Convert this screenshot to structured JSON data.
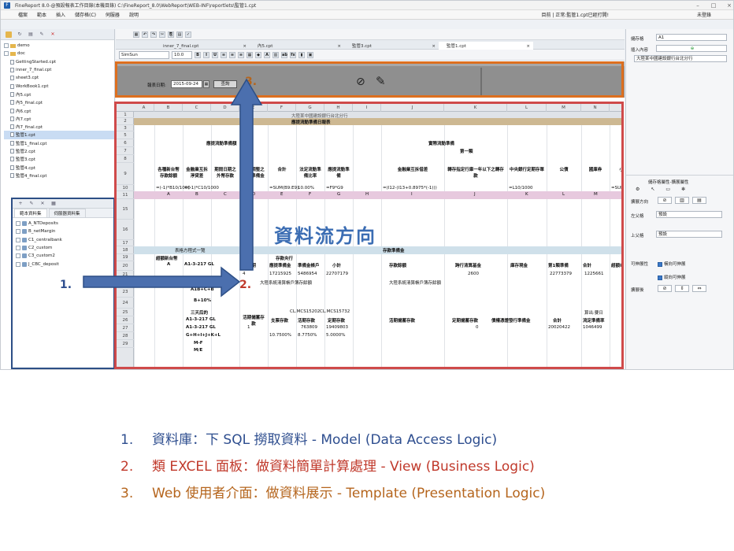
{
  "window": {
    "title": "FineReport 8.0-@預設報表工作目錄(本機目錄)   C:\\FineReport_8.0\\WebReport\\WEB-INF\\reportlets\\監管1.cpt",
    "status": "目前 | 正常:監管1.cpt已經打開!",
    "login": "未登錄"
  },
  "menu": [
    "檔案",
    "範本",
    "插入",
    "儲存格(C)",
    "伺服器",
    "說明"
  ],
  "file_tree": {
    "items": [
      "demo",
      "doc",
      "GettingStarted.cpt",
      "inner_7_final.cpt",
      "sheet3.cpt",
      "WorkBook1.cpt",
      "內5.cpt",
      "內5_final.cpt",
      "內6.cpt",
      "內7.cpt",
      "內7_final.cpt",
      "監管1.cpt",
      "監管1_final.cpt",
      "監管2.cpt",
      "監管3.cpt",
      "監管4.cpt",
      "監管4_final.cpt"
    ],
    "selected_index": 11
  },
  "datasets": {
    "tabs": [
      "範本資料集",
      "伺服器資料集"
    ],
    "items": [
      "A_NTDeposits",
      "B_netMargin",
      "C1_centralbank",
      "C2_custom",
      "C3_custom2",
      "J_CBC_deposit"
    ]
  },
  "editor": {
    "tabs": [
      "inner_7_final.cpt",
      "內5.cpt",
      "監管3.cpt",
      "監管1.cpt"
    ],
    "font": "SimSun",
    "font_size": "10.0"
  },
  "param_pane": {
    "date_label": "報表日期:",
    "date_value": "2015-09-24",
    "query_label": "查詢"
  },
  "grid": {
    "columns": [
      "A",
      "B",
      "C",
      "D",
      "E",
      "F",
      "G",
      "H",
      "I",
      "J",
      "K",
      "L",
      "M",
      "N",
      "O"
    ],
    "rows": [
      "1",
      "2",
      "3",
      "5",
      "6",
      "7",
      "8",
      "9",
      "10",
      "11",
      "15",
      "16",
      "17",
      "18",
      "19",
      "20",
      "21",
      "22",
      "23",
      "24",
      "25",
      "26",
      "27",
      "28",
      "29"
    ],
    "title1": "大陸某中國建設銀行台北分行",
    "title2": "應提流動準備日報表",
    "overlay_title": "資料流方向",
    "cells": {
      "h_left": "應提流動準備額",
      "h_right": "實際流動準備",
      "h_first": "第一類",
      "c_ntd": "各種新台幣存款餘額",
      "c_amt": "金融業互拆淨貸差",
      "c_redo": "期間日期之外幣存款",
      "c_ratio": "繼續調整之存款準備金",
      "c_sum": "合計",
      "c_legal": "法定流動準備比率",
      "c_need": "應提流動準備",
      "c_excess": "超額準備",
      "c_interbank": "金融業互拆借差",
      "c_central": "轉存指定行庫一年以下之轉存款",
      "c_cb": "中央銀行定期存單",
      "c_bond": "公債",
      "c_treasury": "國庫券",
      "c_total": "小計",
      "f_b9": "=(-1)*B10/1000",
      "f_c9": "=(-1)*C10/1000",
      "f_e9": "0.00",
      "f_f9": "=SUM(B9:E9)",
      "f_g9": "10.00%",
      "f_h9": "=F9*G9",
      "f_i9": "=(I12-(I13+0.8975*(-1)))",
      "f_l9": "=L10/1000",
      "f_o9": "=SUM(I9:N9)",
      "r11": [
        "A",
        "B",
        "C",
        "D",
        "E",
        "F",
        "G",
        "H",
        "I",
        "J",
        "K",
        "L",
        "M"
      ],
      "ref_table": "表格方程式一覽",
      "dep_res": "存款準備金",
      "ntd_margin": "超額新台幣",
      "date": "日期",
      "dep_cb": "存款央行",
      "req_res": "應提準備金",
      "dep_sum": "準備金帳戶",
      "sub": "小計",
      "daily_bal": "存款餘額",
      "tdr": "跨行清算基金",
      "res_acct": "庫存現金",
      "req_b": "第1類準備",
      "total2": "合計",
      "over": "超額或不足",
      "r20_e": "4",
      "r20_f": "17215925",
      "r20_g": "5486954",
      "r20_h": "22707179",
      "r20_k": "2600",
      "r20_m": "22773379",
      "r20_n": "1225661",
      "note1": "大陸系統清算帳戶簿存餘額",
      "note2": "大陸系統清算帳戶簿存餘額",
      "e22": "A1B+C+B",
      "f23": "B+10%",
      "e24": "三天后的",
      "g24": "CL.MCS15202",
      "h24": "CL.MCS15732",
      "o24": "算出:要日",
      "e25": "A1-3-217 GL",
      "e26": "A1-3-217 GL",
      "e27": "G+H+I+J+K+L",
      "e28": "M-F",
      "e29": "M/E",
      "live": "活期儲蓄存款",
      "cd": "支票存款",
      "lcd": "活期存款",
      "fix": "定期存款",
      "live2": "活期儲蓄存款",
      "fix2": "定期儲蓄存款",
      "bond2": "債權憑證發行準備金",
      "sum3": "合計",
      "ratio3": "流定準備率",
      "r27_e": "1",
      "r27_g": "763809",
      "r27_h": "19409803",
      "r27_k": "0",
      "r27_m": "20020422",
      "r27_n": "1046499",
      "r28_f": "10.7500%",
      "r28_g": "8.7750%",
      "r28_h": "5.0000%",
      "col_b20": "A1-3-217 GL",
      "b21": "A"
    }
  },
  "right_panel": {
    "cell_label": "儲存格",
    "cell_value": "A1",
    "insert_label": "插入內容",
    "content_value": "大陸某中國建設銀行台北分行",
    "attr_title": "儲存格屬性-擴展屬性",
    "expand_dir": "擴展方向",
    "left_parent": "左父格",
    "left_value": "預設",
    "up_parent": "上父格",
    "up_value": "預設",
    "expandable": "可伸展性",
    "opt1": "橫向可伸展",
    "opt2": "縱向可伸展",
    "expand_after": "擴展後"
  },
  "annotations": {
    "n1": "1.",
    "n2": "2.",
    "n3": "3."
  },
  "legend": [
    {
      "num": "1.",
      "text": "資料庫：下 SQL 撈取資料  - Model (Data Access Logic)",
      "color": "#2e4e8f"
    },
    {
      "num": "2.",
      "text": "類 EXCEL 面板：做資料簡單計算處理  - View (Business Logic)",
      "color": "#c0392b"
    },
    {
      "num": "3.",
      "text": "Web 使用者介面：做資料展示  - Template (Presentation Logic)",
      "color": "#b5651d"
    }
  ]
}
